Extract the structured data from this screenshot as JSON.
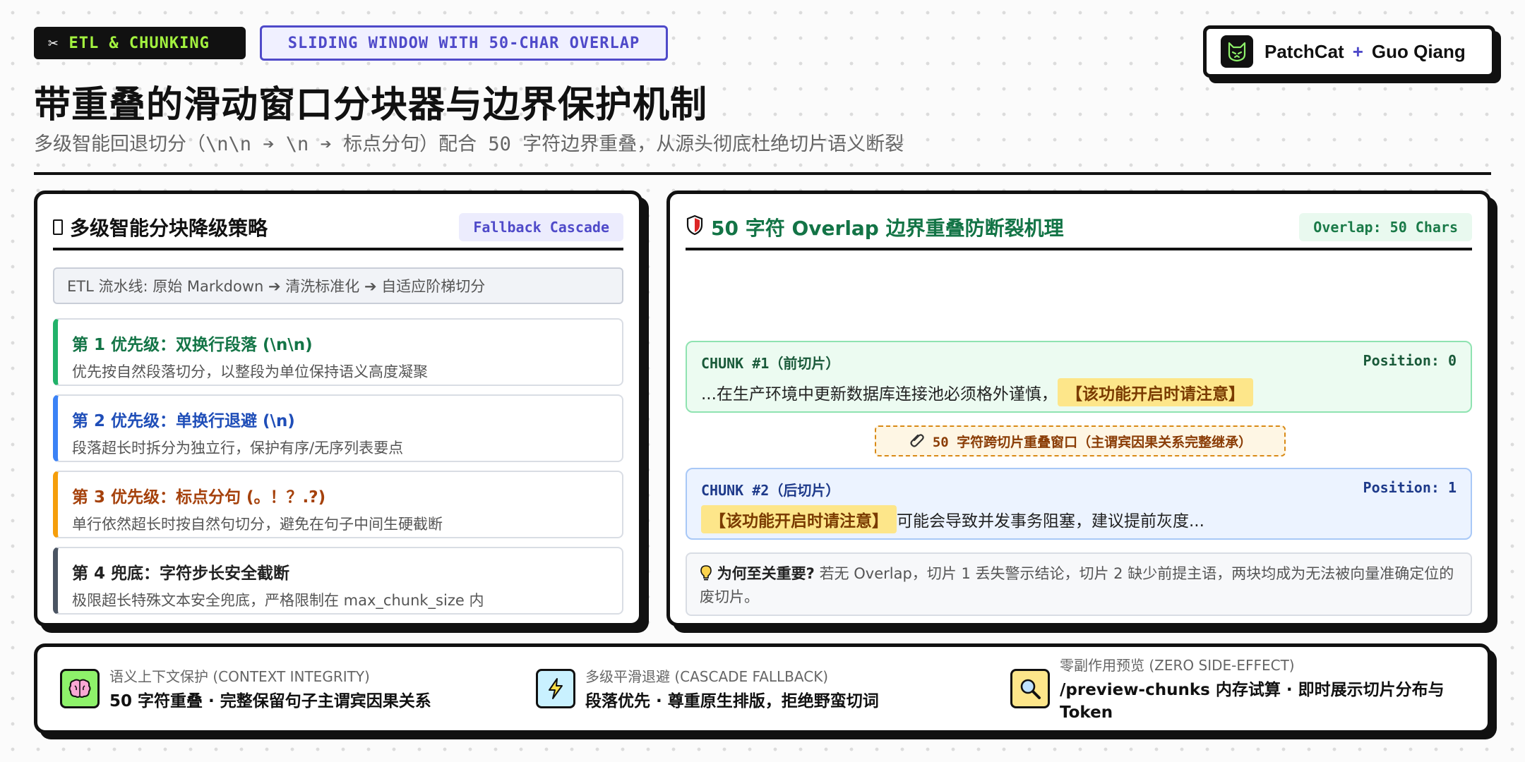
{
  "header": {
    "tag_primary": "ETL & CHUNKING",
    "tag_secondary": "SLIDING WINDOW WITH 50-CHAR OVERLAP",
    "title": "带重叠的滑动窗口分块器与边界保护机制",
    "subtitle": "多级智能回退切分（\\n\\n ➔ \\n ➔ 标点分句）配合 50 字符边界重叠，从源头彻底杜绝切片语义断裂",
    "brand_name": "PatchCat",
    "brand_plus": "+",
    "brand_partner": "Guo Qiang"
  },
  "left_panel": {
    "title": "多级智能分块降级策略",
    "badge": "Fallback Cascade",
    "pipeline": "ETL 流水线: 原始 Markdown ➔ 清洗标准化 ➔ 自适应阶梯切分",
    "levels": [
      {
        "title": "第 1 优先级：双换行段落 (\\n\\n)",
        "desc": "优先按自然段落切分，以整段为单位保持语义高度凝聚"
      },
      {
        "title": "第 2 优先级：单换行退避 (\\n)",
        "desc": "段落超长时拆分为独立行，保护有序/无序列表要点"
      },
      {
        "title": "第 3 优先级：标点分句 (。！？.?)",
        "desc": "单行依然超长时按自然句切分，避免在句子中间生硬截断"
      },
      {
        "title": "第 4 兜底：字符步长安全截断",
        "desc": "极限超长特殊文本安全兜底，严格限制在 max_chunk_size 内"
      }
    ]
  },
  "right_panel": {
    "title": "50 字符 Overlap 边界重叠防断裂机理",
    "badge": "Overlap: 50 Chars",
    "chunk1": {
      "label": "CHUNK #1（前切片）",
      "position": "Position: 0",
      "text": "...在生产环境中更新数据库连接池必须格外谨慎，",
      "highlight": "【该功能开启时请注意】"
    },
    "overlap_label": "50 字符跨切片重叠窗口（主谓宾因果关系完整继承）",
    "chunk2": {
      "label": "CHUNK #2（后切片）",
      "position": "Position: 1",
      "highlight": "【该功能开启时请注意】",
      "text": "可能会导致并发事务阻塞，建议提前灰度..."
    },
    "why_title": "为何至关重要?",
    "why_text": "若无 Overlap，切片 1 丢失警示结论，切片 2 缺少前提主语，两块均成为无法被向量准确定位的废切片。"
  },
  "footer": {
    "features": [
      {
        "label": "语义上下文保护 (CONTEXT INTEGRITY)",
        "value": "50 字符重叠 · 完整保留句子主谓宾因果关系",
        "icon": "brain-icon"
      },
      {
        "label": "多级平滑退避 (CASCADE FALLBACK)",
        "value": "段落优先 · 尊重原生排版，拒绝野蛮切词",
        "icon": "lightning-icon"
      },
      {
        "label": "零副作用预览 (ZERO SIDE-EFFECT)",
        "value": "/preview-chunks 内存试算 · 即时展示切片分布与 Token",
        "icon": "magnifier-icon"
      }
    ]
  },
  "colors": {
    "accent_purple": "#4f4ac9",
    "accent_green": "#22b26a",
    "accent_blue": "#3b82f6",
    "accent_orange": "#f59e0b",
    "tag_lime": "#a3f23f"
  }
}
